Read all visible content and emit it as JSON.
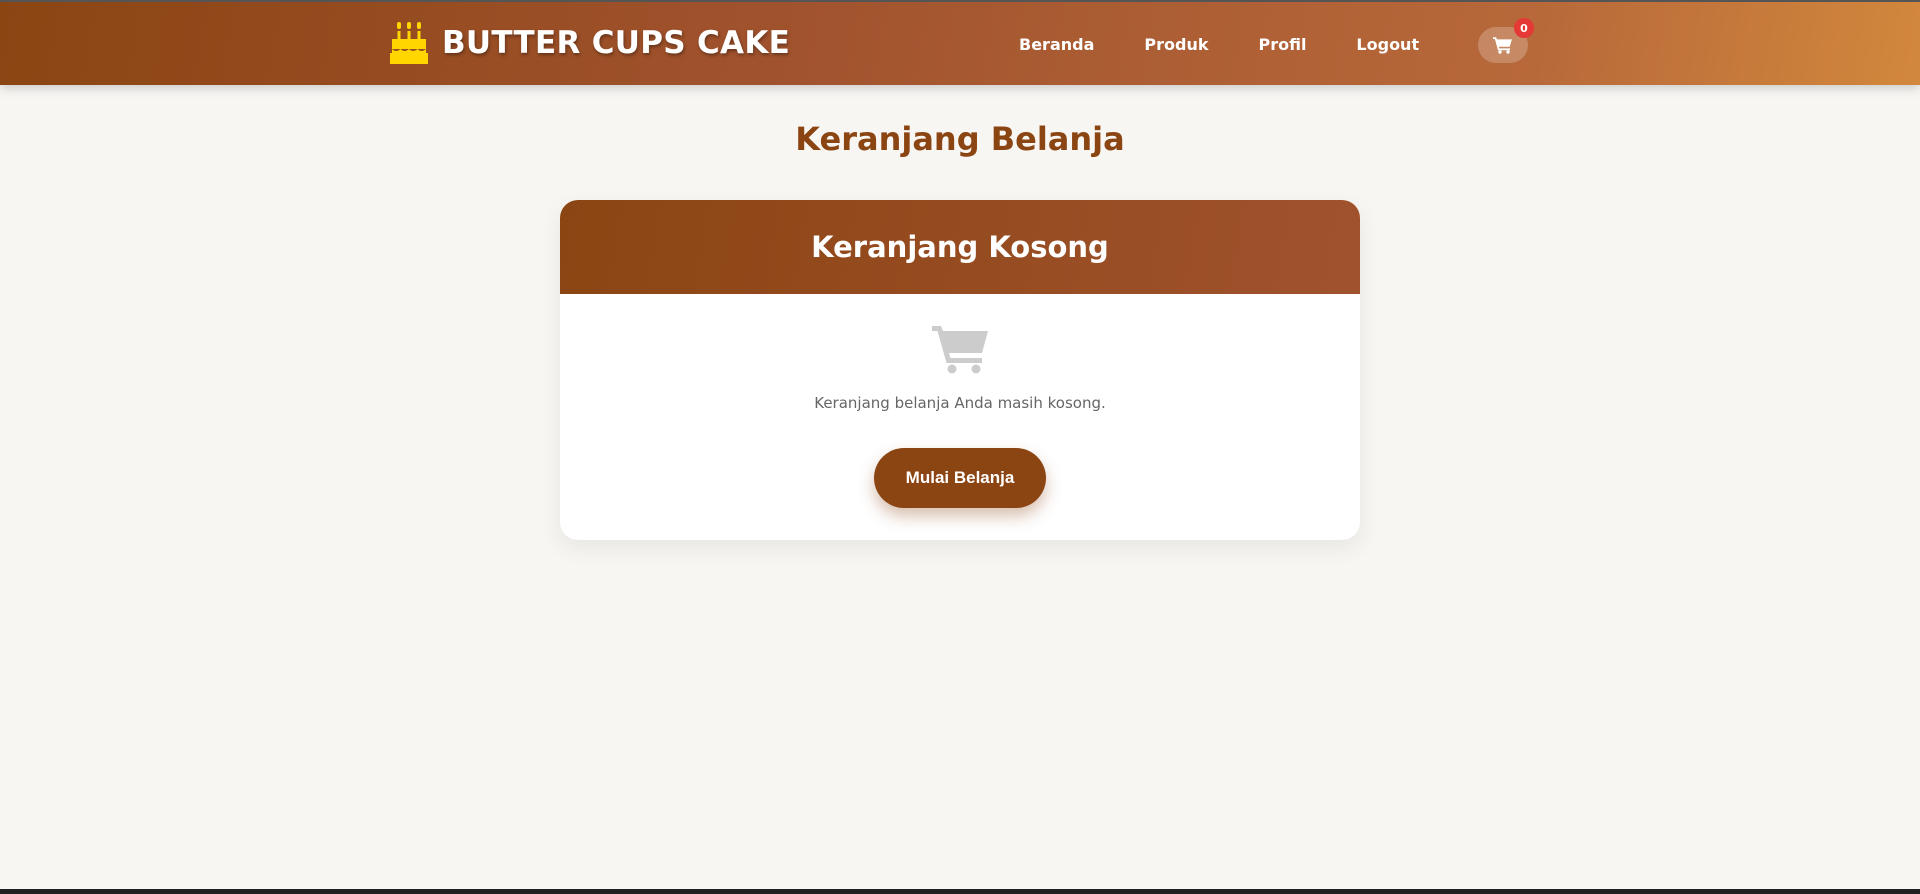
{
  "header": {
    "brand_name": "BUTTER CUPS CAKE",
    "brand_icon": "birthday-cake-icon",
    "nav": [
      {
        "label": "Beranda"
      },
      {
        "label": "Produk"
      },
      {
        "label": "Profil"
      },
      {
        "label": "Logout"
      }
    ],
    "cart": {
      "icon": "shopping-cart-icon",
      "count": "0"
    }
  },
  "main": {
    "title": "Keranjang Belanja",
    "card": {
      "header_title": "Keranjang Kosong",
      "empty_icon": "shopping-cart-icon",
      "message": "Keranjang belanja Anda masih kosong.",
      "button_label": "Mulai Belanja"
    }
  },
  "colors": {
    "brand_brown": "#8b4513",
    "accent_orange": "#d2883c",
    "badge_red": "#e53935",
    "background": "#f8f6f3"
  }
}
